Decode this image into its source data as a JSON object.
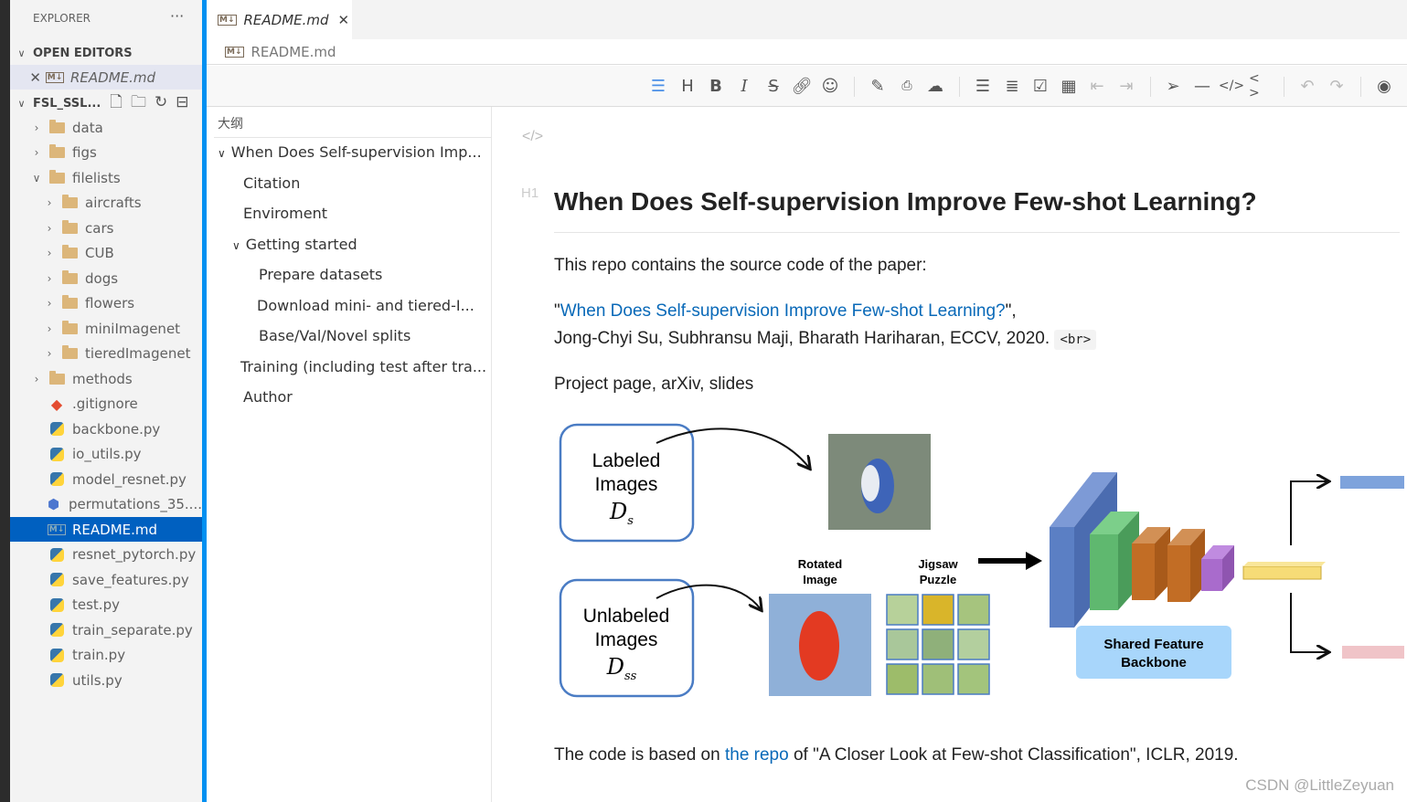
{
  "explorer": {
    "title": "EXPLORER",
    "more": "···",
    "open_editors": {
      "label": "OPEN EDITORS",
      "items": [
        {
          "name": "README.md"
        }
      ]
    },
    "project": {
      "label": "FSL_SSL...",
      "items": [
        {
          "name": "data",
          "type": "folder",
          "expanded": false,
          "depth": 0
        },
        {
          "name": "figs",
          "type": "folder",
          "expanded": false,
          "depth": 0
        },
        {
          "name": "filelists",
          "type": "folder",
          "expanded": true,
          "depth": 0
        },
        {
          "name": "aircrafts",
          "type": "folder",
          "expanded": false,
          "depth": 1
        },
        {
          "name": "cars",
          "type": "folder",
          "expanded": false,
          "depth": 1
        },
        {
          "name": "CUB",
          "type": "folder",
          "expanded": false,
          "depth": 1
        },
        {
          "name": "dogs",
          "type": "folder",
          "expanded": false,
          "depth": 1
        },
        {
          "name": "flowers",
          "type": "folder",
          "expanded": false,
          "depth": 1
        },
        {
          "name": "miniImagenet",
          "type": "folder",
          "expanded": false,
          "depth": 1
        },
        {
          "name": "tieredImagenet",
          "type": "folder",
          "expanded": false,
          "depth": 1
        },
        {
          "name": "methods",
          "type": "folder",
          "expanded": false,
          "depth": 0
        },
        {
          "name": ".gitignore",
          "type": "git",
          "depth": 0
        },
        {
          "name": "backbone.py",
          "type": "py",
          "depth": 0
        },
        {
          "name": "io_utils.py",
          "type": "py",
          "depth": 0
        },
        {
          "name": "model_resnet.py",
          "type": "py",
          "depth": 0
        },
        {
          "name": "permutations_35....",
          "type": "npy",
          "depth": 0
        },
        {
          "name": "README.md",
          "type": "md",
          "depth": 0,
          "selected": true
        },
        {
          "name": "resnet_pytorch.py",
          "type": "py",
          "depth": 0
        },
        {
          "name": "save_features.py",
          "type": "py",
          "depth": 0
        },
        {
          "name": "test.py",
          "type": "py",
          "depth": 0
        },
        {
          "name": "train_separate.py",
          "type": "py",
          "depth": 0
        },
        {
          "name": "train.py",
          "type": "py",
          "depth": 0
        },
        {
          "name": "utils.py",
          "type": "py",
          "depth": 0
        }
      ]
    }
  },
  "tab": {
    "label": "README.md",
    "close": "✕"
  },
  "breadcrumb": "README.md",
  "toolbar": [
    "heading-outline",
    "H",
    "B",
    "I",
    "S",
    "link",
    "emoji",
    "|",
    "edit",
    "pdf",
    "upload",
    "|",
    "ul",
    "ol",
    "checkbox",
    "table",
    "outdent",
    "indent",
    "|",
    "send",
    "hr",
    "code",
    "inline-code",
    "|",
    "undo",
    "redo",
    "|",
    "preview"
  ],
  "outline": {
    "title": "大纲",
    "items": [
      {
        "label": "When Does Self-supervision Imp...",
        "level": 1,
        "expanded": true
      },
      {
        "label": "Citation",
        "level": 2
      },
      {
        "label": "Enviroment",
        "level": 2
      },
      {
        "label": "Getting started",
        "level": 2,
        "expanded": true
      },
      {
        "label": "Prepare datasets",
        "level": 3
      },
      {
        "label": "Download mini- and tiered-I...",
        "level": 3
      },
      {
        "label": "Base/Val/Novel splits",
        "level": 3
      },
      {
        "label": "Training (including test after tra...",
        "level": 2
      },
      {
        "label": "Author",
        "level": 2
      }
    ]
  },
  "doc": {
    "html_marker": "</>",
    "h1_marker": "H1",
    "title": "When Does Self-supervision Improve Few-shot Learning?",
    "intro": "This repo contains the source code of the paper:",
    "q1": "\"",
    "paper_link": "When Does Self-supervision Improve Few-shot Learning?",
    "q2": "\",",
    "authors": "Jong-Chyi Su, Subhransu Maji, Bharath Hariharan, ECCV, 2020.",
    "br": "<br>",
    "links": [
      "Project page",
      ", ",
      "arXiv",
      ", ",
      "slides"
    ],
    "figure": {
      "labeled": "Labeled",
      "unlabeled": "Unlabeled",
      "images": "Images",
      "ds": "D",
      "ds_sub": "s",
      "dss_sub": "ss",
      "rotated1": "Rotated",
      "rotated2": "Image",
      "jigsaw1": "Jigsaw",
      "jigsaw2": "Puzzle",
      "backbone1": "Shared Feature",
      "backbone2": "Backbone"
    },
    "based_pre": "The code is based on ",
    "based_link": "the repo",
    "based_post": " of \"A Closer Look at Few-shot Classification\", ICLR, 2019."
  },
  "watermark": "CSDN @LittleZeyuan",
  "colors": {
    "accent": "#0090f1",
    "selection": "#0060c0",
    "link": "#0969b8"
  }
}
